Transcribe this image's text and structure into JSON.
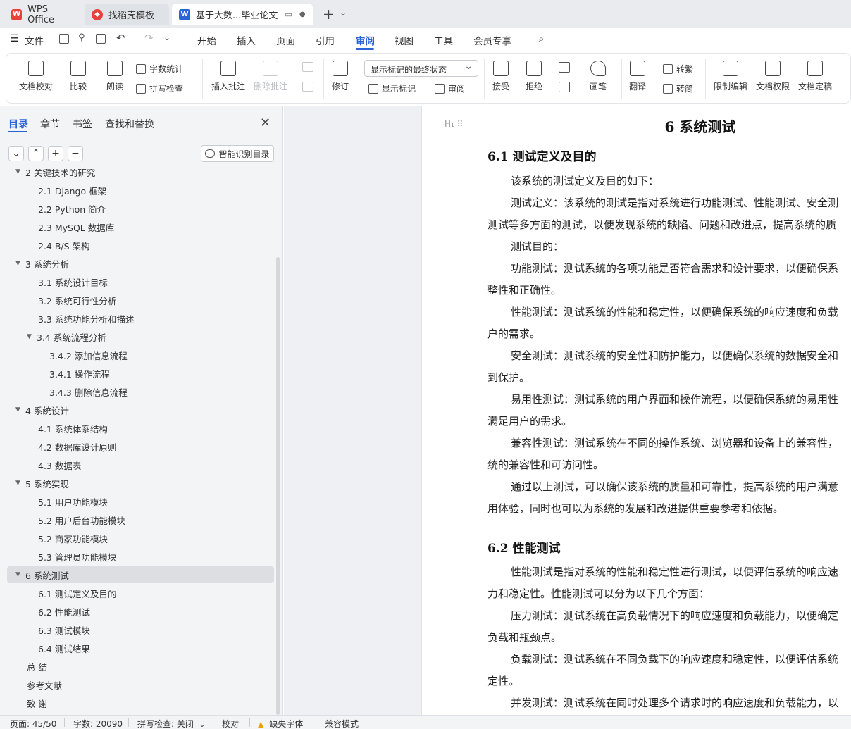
{
  "tabs": {
    "wps": "WPS Office",
    "template": "找稻壳模板",
    "document": "基于大数...毕业论文"
  },
  "menu": {
    "file": "文件",
    "items": [
      "开始",
      "插入",
      "页面",
      "引用",
      "审阅",
      "视图",
      "工具",
      "会员专享"
    ]
  },
  "ribbon": {
    "doc_check": "文档校对",
    "compare": "比较",
    "read_aloud": "朗读",
    "word_count": "字数统计",
    "spell_check": "拼写检查",
    "insert_comment": "插入批注",
    "delete_comment": "删除批注",
    "track_changes": "修订",
    "markup_state": "显示标记的最终状态",
    "show_markup": "显示标记",
    "review_pane": "审阅",
    "accept": "接受",
    "reject": "拒绝",
    "ink": "画笔",
    "translate": "翻译",
    "to_traditional": "转繁",
    "to_simplified": "转简",
    "restrict_edit": "限制编辑",
    "doc_permission": "文档权限",
    "doc_finalize": "文档定稿"
  },
  "sidebar": {
    "tabs": [
      "目录",
      "章节",
      "书签",
      "查找和替换"
    ],
    "smart_toc": "智能识别目录",
    "toc": [
      {
        "label": "2  关键技术的研究",
        "level": 1,
        "expanded": true
      },
      {
        "label": "2.1 Django 框架",
        "level": 2
      },
      {
        "label": "2.2 Python 简介",
        "level": 2
      },
      {
        "label": "2.3 MySQL 数据库",
        "level": 2
      },
      {
        "label": "2.4 B/S 架构",
        "level": 2
      },
      {
        "label": "3  系统分析",
        "level": 1,
        "expanded": true
      },
      {
        "label": "3.1  系统设计目标",
        "level": 2
      },
      {
        "label": "3.2  系统可行性分析",
        "level": 2
      },
      {
        "label": "3.3  系统功能分析和描述",
        "level": 2
      },
      {
        "label": "3.4 系统流程分析",
        "level": 2,
        "expanded": true
      },
      {
        "label": "3.4.2 添加信息流程",
        "level": 3
      },
      {
        "label": "3.4.1 操作流程",
        "level": 3
      },
      {
        "label": "3.4.3 删除信息流程",
        "level": 3
      },
      {
        "label": "4  系统设计",
        "level": 1,
        "expanded": true
      },
      {
        "label": "4.1  系统体系结构",
        "level": 2
      },
      {
        "label": "4.2  数据库设计原则",
        "level": 2
      },
      {
        "label": "4.3  数据表",
        "level": 2
      },
      {
        "label": "5  系统实现",
        "level": 1,
        "expanded": true
      },
      {
        "label": "5.1 用户功能模块",
        "level": 2
      },
      {
        "label": "5.2 用户后台功能模块",
        "level": 2
      },
      {
        "label": "5.2 商家功能模块",
        "level": 2
      },
      {
        "label": "5.3 管理员功能模块",
        "level": 2
      },
      {
        "label": "6  系统测试",
        "level": 1,
        "expanded": true,
        "active": true
      },
      {
        "label": "6.1 测试定义及目的",
        "level": 2
      },
      {
        "label": "6.2 性能测试",
        "level": 2
      },
      {
        "label": "6.3 测试模块",
        "level": 2
      },
      {
        "label": "6.4 测试结果",
        "level": 2
      },
      {
        "label": "总    结",
        "level": 1
      },
      {
        "label": "参考文献",
        "level": 1
      },
      {
        "label": "致    谢",
        "level": 1
      }
    ]
  },
  "document": {
    "chapter_title": "6  系统测试",
    "section1_title": "6.1 测试定义及目的",
    "section2_title": "6.2 性能测试",
    "lines1": [
      {
        "text": "该系统的测试定义及目的如下：",
        "indent": true
      },
      {
        "text": "测试定义：该系统的测试是指对系统进行功能测试、性能测试、安全测",
        "indent": true
      },
      {
        "text": "测试等多方面的测试，以便发现系统的缺陷、问题和改进点，提高系统的质",
        "indent": false
      },
      {
        "text": "测试目的：",
        "indent": true
      },
      {
        "text": "功能测试：测试系统的各项功能是否符合需求和设计要求，以便确保系",
        "indent": true
      },
      {
        "text": "整性和正确性。",
        "indent": false
      },
      {
        "text": "性能测试：测试系统的性能和稳定性，以便确保系统的响应速度和负载",
        "indent": true
      },
      {
        "text": "户的需求。",
        "indent": false
      },
      {
        "text": "安全测试：测试系统的安全性和防护能力，以便确保系统的数据安全和",
        "indent": true
      },
      {
        "text": "到保护。",
        "indent": false
      },
      {
        "text": "易用性测试：测试系统的用户界面和操作流程，以便确保系统的易用性",
        "indent": true
      },
      {
        "text": "满足用户的需求。",
        "indent": false
      },
      {
        "text": "兼容性测试：测试系统在不同的操作系统、浏览器和设备上的兼容性，",
        "indent": true
      },
      {
        "text": "统的兼容性和可访问性。",
        "indent": false
      },
      {
        "text": "通过以上测试，可以确保该系统的质量和可靠性，提高系统的用户满意",
        "indent": true
      },
      {
        "text": "用体验，同时也可以为系统的发展和改进提供重要参考和依据。",
        "indent": false
      }
    ],
    "lines2": [
      {
        "text": "性能测试是指对系统的性能和稳定性进行测试，以便评估系统的响应速",
        "indent": true
      },
      {
        "text": "力和稳定性。性能测试可以分为以下几个方面：",
        "indent": false
      },
      {
        "text": "压力测试：测试系统在高负载情况下的响应速度和负载能力，以便确定",
        "indent": true
      },
      {
        "text": "负载和瓶颈点。",
        "indent": false
      },
      {
        "text": "负载测试：测试系统在不同负载下的响应速度和稳定性，以便评估系统",
        "indent": true
      },
      {
        "text": "定性。",
        "indent": false
      },
      {
        "text": "并发测试：测试系统在同时处理多个请求时的响应速度和负载能力，以",
        "indent": true
      }
    ]
  },
  "status": {
    "page": "页面: 45/50",
    "words": "字数: 20090",
    "spell": "拼写检查: 关闭",
    "proof": "校对",
    "missing_font": "缺失字体",
    "compat": "兼容模式"
  },
  "colors": {
    "accent": "#2a63d8",
    "wps_red": "#e8403a"
  }
}
